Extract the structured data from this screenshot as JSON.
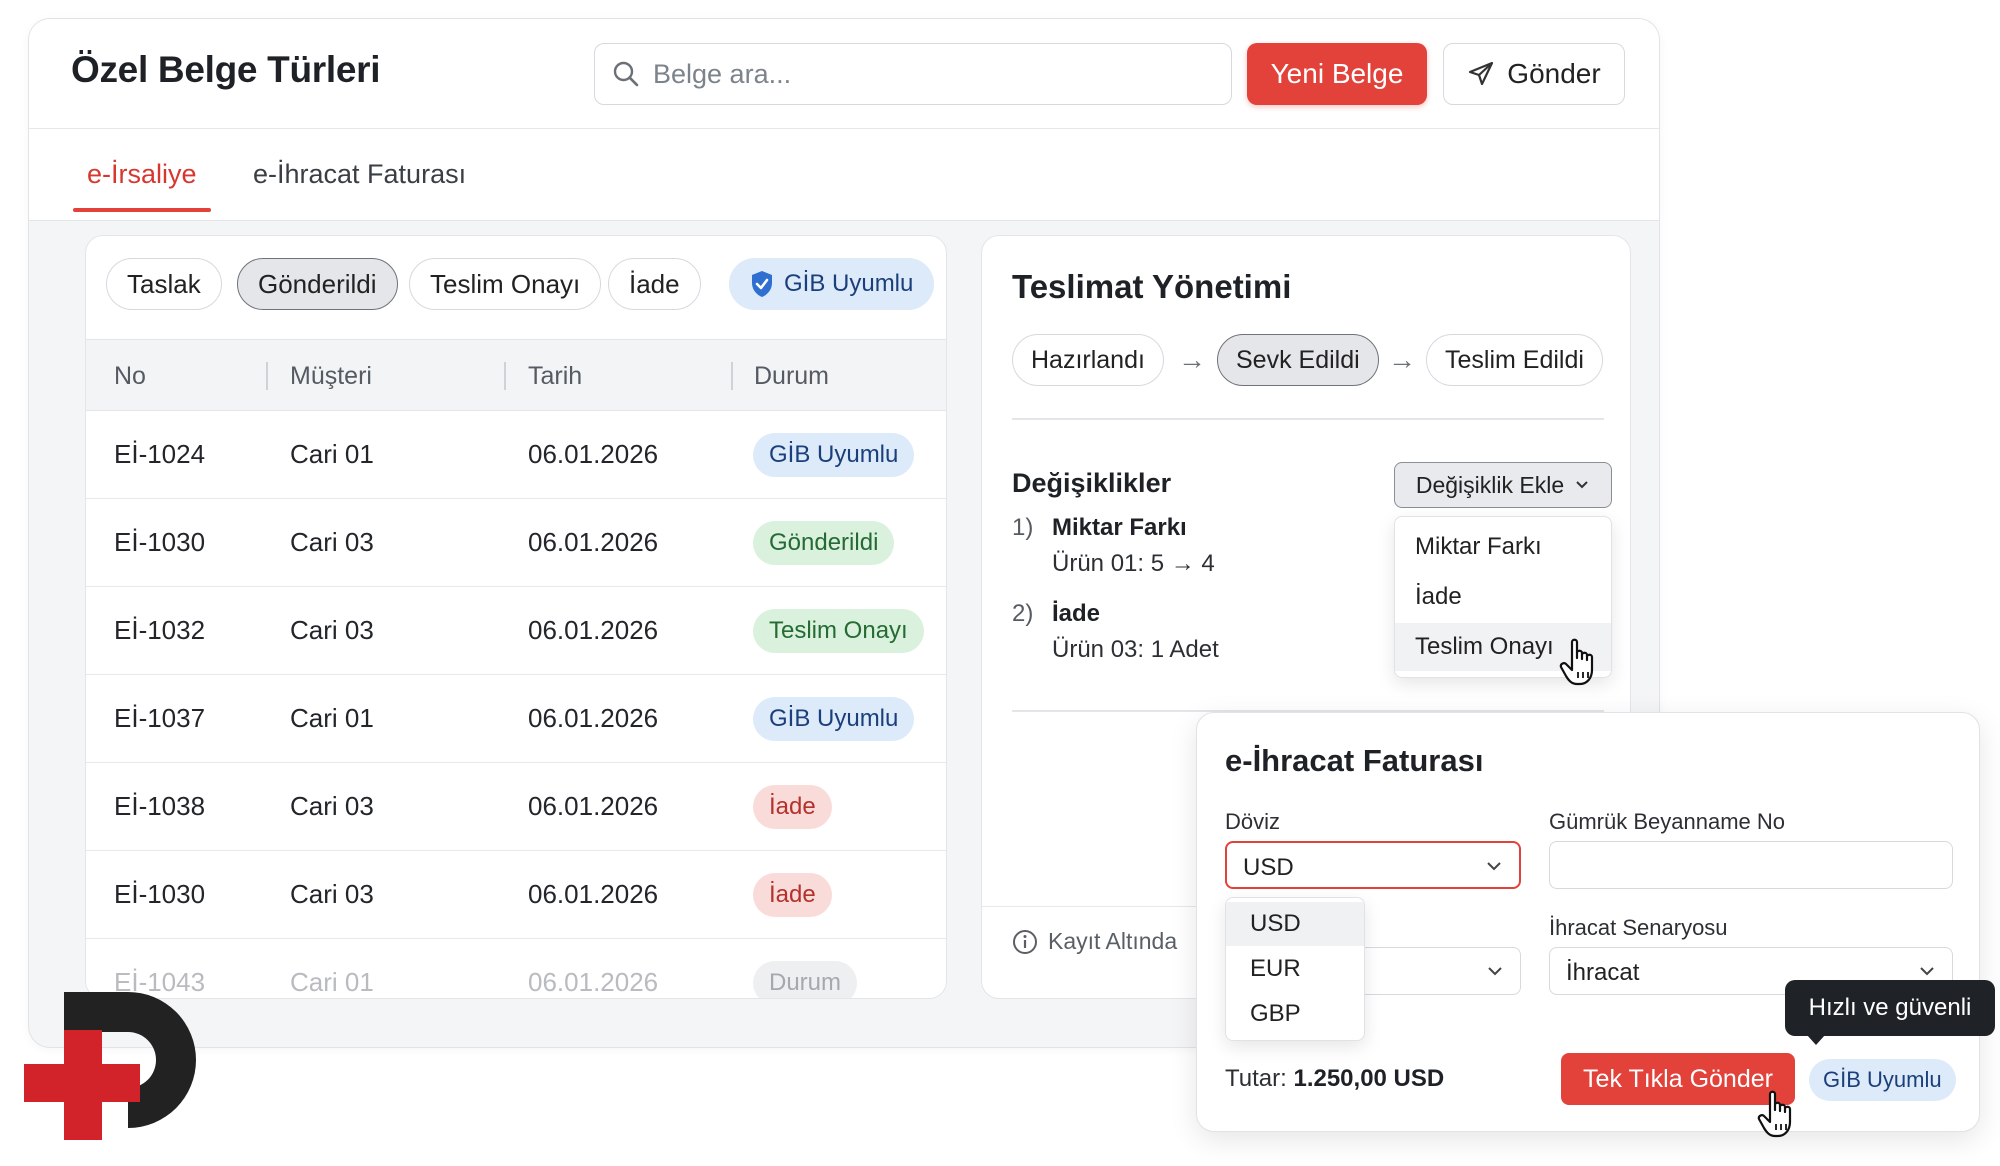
{
  "header": {
    "title": "Özel Belge Türleri",
    "search_placeholder": "Belge ara...",
    "new_button": "Yeni Belge",
    "send_button": "Gönder"
  },
  "tabs": [
    {
      "label": "e-İrsaliye",
      "active": true
    },
    {
      "label": "e-İhracat Faturası",
      "active": false
    }
  ],
  "filters": {
    "chips": [
      "Taslak",
      "Gönderildi",
      "Teslim Onayı",
      "İade"
    ],
    "selected": "Gönderildi",
    "gib_label": "GİB Uyumlu"
  },
  "table": {
    "columns": [
      "No",
      "Müşteri",
      "Tarih",
      "Durum"
    ],
    "rows": [
      {
        "no": "Eİ-1024",
        "customer": "Cari 01",
        "date": "06.01.2026",
        "status": "GİB Uyumlu",
        "color": "blue"
      },
      {
        "no": "Eİ-1030",
        "customer": "Cari 03",
        "date": "06.01.2026",
        "status": "Gönderildi",
        "color": "green"
      },
      {
        "no": "Eİ-1032",
        "customer": "Cari 03",
        "date": "06.01.2026",
        "status": "Teslim Onayı",
        "color": "green"
      },
      {
        "no": "Eİ-1037",
        "customer": "Cari 01",
        "date": "06.01.2026",
        "status": "GİB Uyumlu",
        "color": "blue"
      },
      {
        "no": "Eİ-1038",
        "customer": "Cari 03",
        "date": "06.01.2026",
        "status": "İade",
        "color": "red"
      },
      {
        "no": "Eİ-1030",
        "customer": "Cari 03",
        "date": "06.01.2026",
        "status": "İade",
        "color": "red"
      },
      {
        "no": "Eİ-1043",
        "customer": "Cari 01",
        "date": "06.01.2026",
        "status": "Durum",
        "color": "gray"
      }
    ]
  },
  "delivery": {
    "title": "Teslimat Yönetimi",
    "steps": [
      "Hazırlandı",
      "Sevk Edildi",
      "Teslim Edildi"
    ],
    "current_step": "Sevk Edildi",
    "changes_title": "Değişiklikler",
    "add_change_button": "Değişiklik Ekle",
    "changes": [
      {
        "num": "1)",
        "title": "Miktar Farkı",
        "detail": "Ürün 01: 5 → 4"
      },
      {
        "num": "2)",
        "title": "İade",
        "detail": "Ürün 03: 1 Adet"
      }
    ],
    "change_menu": [
      "Miktar Farkı",
      "İade",
      "Teslim Onayı"
    ],
    "change_menu_hover": "Teslim Onayı",
    "footer_note": "Kayıt Altında"
  },
  "export_invoice": {
    "title": "e-İhracat Faturası",
    "currency_label": "Döviz",
    "currency_value": "USD",
    "currency_options": [
      "USD",
      "EUR",
      "GBP"
    ],
    "customs_label": "Gümrük Beyanname No",
    "customs_value": "",
    "scenario_label": "İhracat Senaryosu",
    "scenario_value": "İhracat",
    "total_label": "Tutar:",
    "total_value": "1.250,00 USD",
    "send_button": "Tek Tıkla Gönder",
    "badge": "GİB Uyumlu",
    "tooltip": "Hızlı ve güvenli"
  },
  "colors": {
    "accent": "#e2423a",
    "badge_blue": "#dceafa",
    "badge_green": "#d9f1dd",
    "badge_red": "#f9dcda",
    "logo_red": "#d2232a",
    "logo_dark": "#222222"
  }
}
